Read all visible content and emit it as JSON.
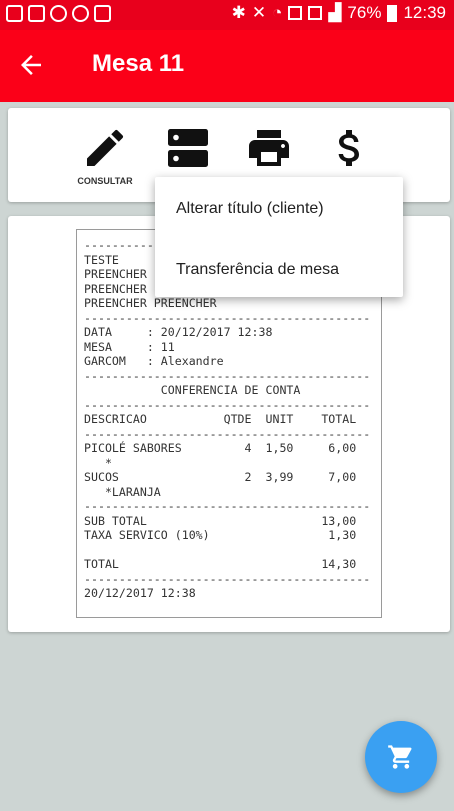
{
  "status_bar": {
    "battery": "76%",
    "time": "12:39"
  },
  "app_bar": {
    "title": "Mesa 11",
    "back_icon": "arrow-left-icon"
  },
  "toolbar": {
    "items": [
      {
        "icon": "pencil-icon",
        "label": "CONSULTAR"
      },
      {
        "icon": "server-icon",
        "label": ""
      },
      {
        "icon": "printer-icon",
        "label": ""
      },
      {
        "icon": "dollar-icon",
        "label": ""
      }
    ]
  },
  "menu": {
    "items": [
      "Alterar título (cliente)",
      "Transferência de mesa"
    ]
  },
  "receipt": {
    "lines": [
      "-----------------------------------------",
      "TESTE",
      "PREENCHER",
      "PREENCHER",
      "PREENCHER PREENCHER",
      "-----------------------------------------",
      "DATA     : 20/12/2017 12:38",
      "MESA     : 11",
      "GARCOM   : Alexandre",
      "-----------------------------------------",
      "           CONFERENCIA DE CONTA",
      "-----------------------------------------",
      "DESCRICAO           QTDE  UNIT    TOTAL",
      "-----------------------------------------",
      "PICOLÉ SABORES         4  1,50     6,00",
      "   *",
      "SUCOS                  2  3,99     7,00",
      "   *LARANJA",
      "-----------------------------------------",
      "SUB TOTAL                         13,00",
      "TAXA SERVICO (10%)                 1,30",
      "",
      "TOTAL                             14,30",
      "-----------------------------------------",
      "20/12/2017 12:38"
    ]
  },
  "fab": {
    "icon": "cart-icon"
  },
  "colors": {
    "primary": "#fb0018",
    "status_bar": "#e8001c",
    "fab": "#3aa0f2",
    "background": "#cdd5d3"
  }
}
